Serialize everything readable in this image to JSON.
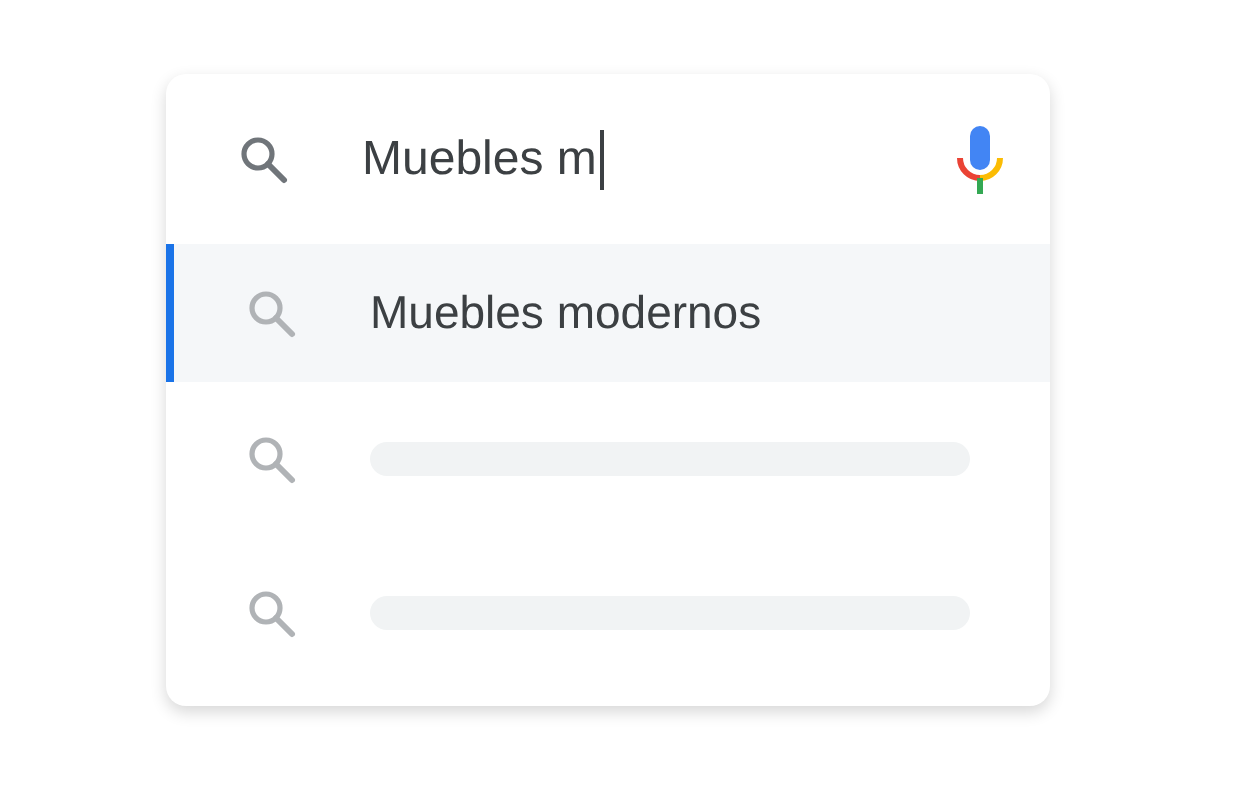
{
  "search": {
    "value": "Muebles m"
  },
  "suggestions": [
    {
      "kind": "text",
      "text": "Muebles modernos",
      "selected": true
    },
    {
      "kind": "placeholder",
      "selected": false
    },
    {
      "kind": "placeholder",
      "selected": false
    }
  ]
}
